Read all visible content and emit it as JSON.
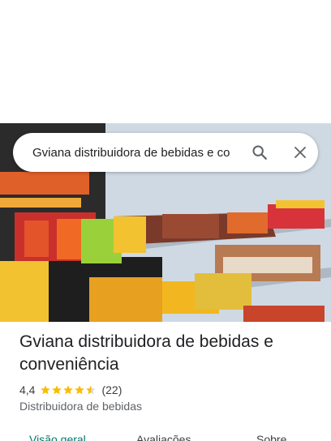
{
  "search": {
    "query": "Gviana distribuidora de bebidas e co",
    "search_icon": "search-icon",
    "close_icon": "close-icon"
  },
  "place": {
    "title": "Gviana distribuidora de bebidas e conveniência",
    "rating": "4,4",
    "stars": 4.4,
    "review_count": "(22)",
    "category": "Distribuidora de bebidas"
  },
  "tabs": [
    {
      "label": "Visão geral",
      "active": true
    },
    {
      "label": "Avaliações",
      "active": false
    },
    {
      "label": "Sobre",
      "active": false
    }
  ],
  "colors": {
    "accent": "#00796b",
    "star": "#fbbc04"
  }
}
